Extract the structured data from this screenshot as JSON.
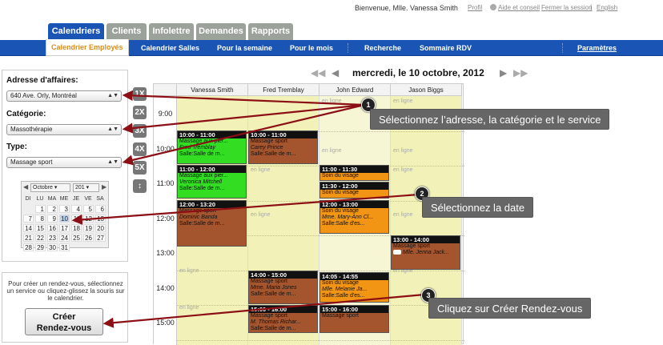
{
  "header": {
    "welcome": "Bienvenue, Mlle. Vanessa Smith",
    "links": [
      "Profil",
      "Aide et conseil",
      "Fermer la session",
      "English"
    ]
  },
  "tabs": [
    "Calendriers",
    "Clients",
    "Infolettre",
    "Demandes",
    "Rapports"
  ],
  "nav": [
    "Calendrier Employés",
    "Calendrier Salles",
    "Pour la semaine",
    "Pour le mois",
    "Recherche",
    "Sommaire RDV",
    "Paramètres"
  ],
  "filters": {
    "address_label": "Adresse d'affaires:",
    "address_value": "640 Ave. Orly, Montréal",
    "category_label": "Catégorie:",
    "category_value": "Massothérapie",
    "type_label": "Type:",
    "type_value": "Massage sport"
  },
  "mini_calendar": {
    "month": "Octobre",
    "year": "201",
    "day_headers": [
      "DI",
      "LU",
      "MA",
      "ME",
      "JE",
      "VE",
      "SA"
    ],
    "weeks": [
      [
        "",
        "1",
        "2",
        "3",
        "4",
        "5",
        "6"
      ],
      [
        "7",
        "8",
        "9",
        "10",
        "11",
        "12",
        "13"
      ],
      [
        "14",
        "15",
        "16",
        "17",
        "18",
        "19",
        "20"
      ],
      [
        "21",
        "22",
        "23",
        "24",
        "25",
        "26",
        "27"
      ],
      [
        "28",
        "29",
        "30",
        "31",
        "",
        "",
        ""
      ]
    ],
    "selected": "10"
  },
  "help_text": "Pour créer un rendez-vous, sélectionnez un service ou cliquez-glissez la souris sur le calendrier.",
  "create_button": [
    "Créer",
    "Rendez-vous"
  ],
  "zoom": [
    "1X",
    "2X",
    "3X",
    "4X",
    "5X"
  ],
  "date_title": "mercredi, le 10 octobre, 2012",
  "employees": [
    "Vanessa Smith",
    "Fred Tremblay",
    "John Edward",
    "Jason Biggs"
  ],
  "hours": [
    "9:00",
    "10:00",
    "11:00",
    "12:00",
    "13:00",
    "14:00",
    "15:00"
  ],
  "online_label": "en ligne",
  "appointments": [
    {
      "time": "10:00 - 11:00",
      "service": "Massage aux pier...",
      "client": "Fred Tremblay",
      "room": "Salle:Salle de m..."
    },
    {
      "time": "10:00 - 11:00",
      "service": "Massage sport",
      "client": "Carey Prince",
      "room": "Salle:Salle de m..."
    },
    {
      "time": "11:00 - 12:00",
      "service": "Massage aux pier...",
      "client": "Veronica Mitchell",
      "room": "Salle:Salle de m..."
    },
    {
      "time": "11:00 - 11:30",
      "service": "Soin du visage",
      "client": "",
      "room": ""
    },
    {
      "time": "11:30 - 12:00",
      "service": "Soin du visage",
      "client": "",
      "room": ""
    },
    {
      "time": "12:00 - 13:20",
      "service": "Massage sport",
      "client": "Dominic Banda",
      "room": "Salle:Salle de m..."
    },
    {
      "time": "12:00 - 13:00",
      "service": "Soin du visage",
      "client": "Mme. Mary-Ann Cl...",
      "room": "Salle:Salle d'es..."
    },
    {
      "time": "13:00 - 14:00",
      "service": "Massage sport",
      "client": "Mlle. Jenna Jack...",
      "room": ""
    },
    {
      "time": "14:00 - 15:00",
      "service": "Massage sport",
      "client": "Mme. Maria Jones",
      "room": "Salle:Salle de m..."
    },
    {
      "time": "14:05 - 14:55",
      "service": "Soin du visage",
      "client": "Mlle. Melanie Ja...",
      "room": "Salle:Salle d'es..."
    },
    {
      "time": "15:00 - 16:00",
      "service": "Massage sport",
      "client": "M. Thomas Richar...",
      "room": "Salle:Salle de m..."
    },
    {
      "time": "15:00 - 16:00",
      "service": "Massage sport",
      "client": "",
      "room": ""
    }
  ],
  "callouts": [
    {
      "num": "1",
      "text": "Sélectionnez l’adresse, la catégorie et le service"
    },
    {
      "num": "2",
      "text": "Sélectionnez la date"
    },
    {
      "num": "3",
      "text": "Cliquez sur Créer Rendez-vous"
    }
  ],
  "colors": {
    "brand_blue": "#1a54b4",
    "active_tab_text": "#d98d15",
    "green": "#33dd22",
    "brown": "#a5552e",
    "orange": "#f29414",
    "column_bg": "#f2f2b8",
    "arrow_red": "#8b0f14"
  }
}
